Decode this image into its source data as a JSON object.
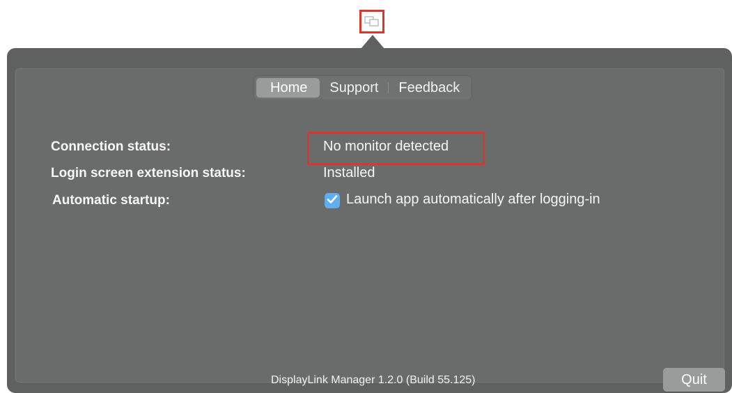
{
  "menubar": {
    "icon": "displaylink-icon"
  },
  "tabs": [
    {
      "label": "Home",
      "active": true
    },
    {
      "label": "Support",
      "active": false
    },
    {
      "label": "Feedback",
      "active": false
    }
  ],
  "home": {
    "connection_label": "Connection status:",
    "connection_value": "No monitor detected",
    "login_label": "Login screen extension status:",
    "login_value": "Installed",
    "startup_label": "Automatic startup:",
    "startup_checkbox_label": "Launch app automatically after logging-in",
    "startup_checked": true
  },
  "footer": {
    "version": "DisplayLink Manager 1.2.0 (Build 55.125)",
    "quit_label": "Quit"
  },
  "colors": {
    "highlight": "#d9372b",
    "popover_bg": "#5f6161",
    "checkbox": "#5eaef0"
  }
}
